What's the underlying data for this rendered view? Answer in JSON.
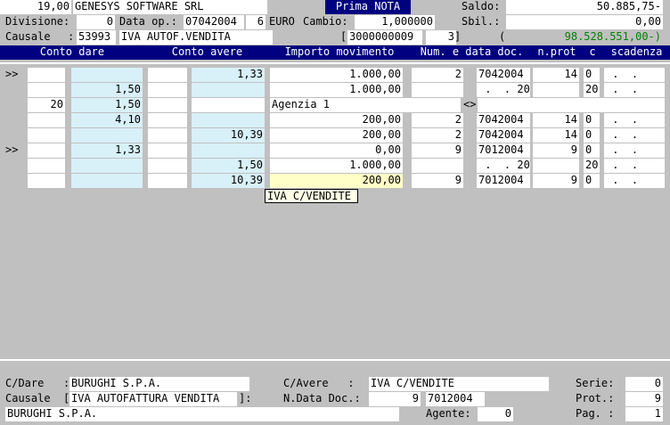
{
  "header": {
    "company_code": "19,00",
    "company_name": "GENESYS SOFTWARE SRL",
    "prima_nota": "Prima NOTA",
    "saldo_label": "Saldo:",
    "saldo_value": "50.885,75-",
    "divisione_label": "Divisione:",
    "divisione_value": "0",
    "data_op_label": "Data op.:",
    "data_op_value": "07042004",
    "data_op_num": "6",
    "euro_label": "EURO",
    "cambio_label": "Cambio:",
    "cambio_value": "1,000000",
    "sbil_label": "Sbil.:",
    "sbil_value": "0,00",
    "causale_label": "Causale",
    "causale_code": "53993",
    "causale_desc": "IVA AUTOF.VENDITA",
    "bracket_left": "[",
    "ref_value": "3000000009",
    "ref_num": "3",
    "bracket_right": "]",
    "paren": "(",
    "total_value": "98.528.551,00-)",
    "col_conto_dare": "Conto dare",
    "col_conto_avere": "Conto avere",
    "col_importo": "Importo movimento",
    "col_num_data": "Num. e data doc.",
    "col_nprot": "n.prot",
    "col_c": "c",
    "col_scadenza": "scadenza"
  },
  "rows": [
    {
      "mark": ">>",
      "dare_a": "",
      "dare_b": "",
      "avere_a": "",
      "avere_b": "1,33",
      "importo": "1.000,00",
      "num": "2",
      "data": "7042004",
      "prot": "14",
      "c": "0",
      "scad": " .  .     0"
    },
    {
      "mark": "",
      "dare_a": "",
      "dare_b": "1,50",
      "avere_a": "",
      "avere_b": "",
      "importo": "1.000,00",
      "num": "",
      "data": " .  . 200",
      "prot": "",
      "c": "20",
      "scad": " .  .     0"
    },
    {
      "mark": "",
      "dare_a": "20",
      "dare_b": "1,50",
      "avere_a": "",
      "avere_b": "",
      "importo": "",
      "agenzia": "Agenzia 1",
      "num": "",
      "data": "",
      "prot": "",
      "c": "",
      "scad": "",
      "diamond": "<>"
    },
    {
      "mark": "",
      "dare_a": "",
      "dare_b": "4,10",
      "avere_a": "",
      "avere_b": "",
      "importo": "200,00",
      "num": "2",
      "data": "7042004",
      "prot": "14",
      "c": "0",
      "scad": " .  .     0"
    },
    {
      "mark": "",
      "dare_a": "",
      "dare_b": "",
      "avere_a": "",
      "avere_b": "10,39",
      "importo": "200,00",
      "num": "2",
      "data": "7042004",
      "prot": "14",
      "c": "0",
      "scad": " .  .     0"
    },
    {
      "mark": ">>",
      "dare_a": "",
      "dare_b": "1,33",
      "avere_a": "",
      "avere_b": "",
      "importo": "0,00",
      "num": "9",
      "data": "7012004",
      "prot": "9",
      "c": "0",
      "scad": " .  .     0"
    },
    {
      "mark": "",
      "dare_a": "",
      "dare_b": "",
      "avere_a": "",
      "avere_b": "1,50",
      "importo": "1.000,00",
      "num": "",
      "data": " .  . 200",
      "prot": "",
      "c": "20",
      "scad": " .  .     0"
    },
    {
      "mark": "",
      "dare_a": "",
      "dare_b": "",
      "avere_a": "",
      "avere_b": "10,39",
      "importo": "200,00",
      "num": "9",
      "data": "7012004",
      "prot": "9",
      "c": "0",
      "scad": " .  .     0",
      "highlight": true
    }
  ],
  "tooltip": "IVA C/VENDITE",
  "footer": {
    "cdare_label": "C/Dare   :",
    "cdare_value": "BURUGHI S.P.A.",
    "cavere_label": "C/Avere   :",
    "cavere_value": "IVA C/VENDITE",
    "serie_label": "Serie:",
    "serie_value": "0",
    "causale_label": "Causale  [",
    "causale_value": "IVA AUTOFATTURA VENDITA",
    "causale_end": "]:",
    "ndata_label": "N.Data Doc.:",
    "ndata_num": "9",
    "ndata_date": "7012004",
    "prot_label": "Prot.:",
    "prot_value": "9",
    "name_value": "BURUGHI S.P.A.",
    "agente_label": "Agente:",
    "agente_value": "0",
    "pag_label": "Pag. :",
    "pag_value": "1"
  }
}
